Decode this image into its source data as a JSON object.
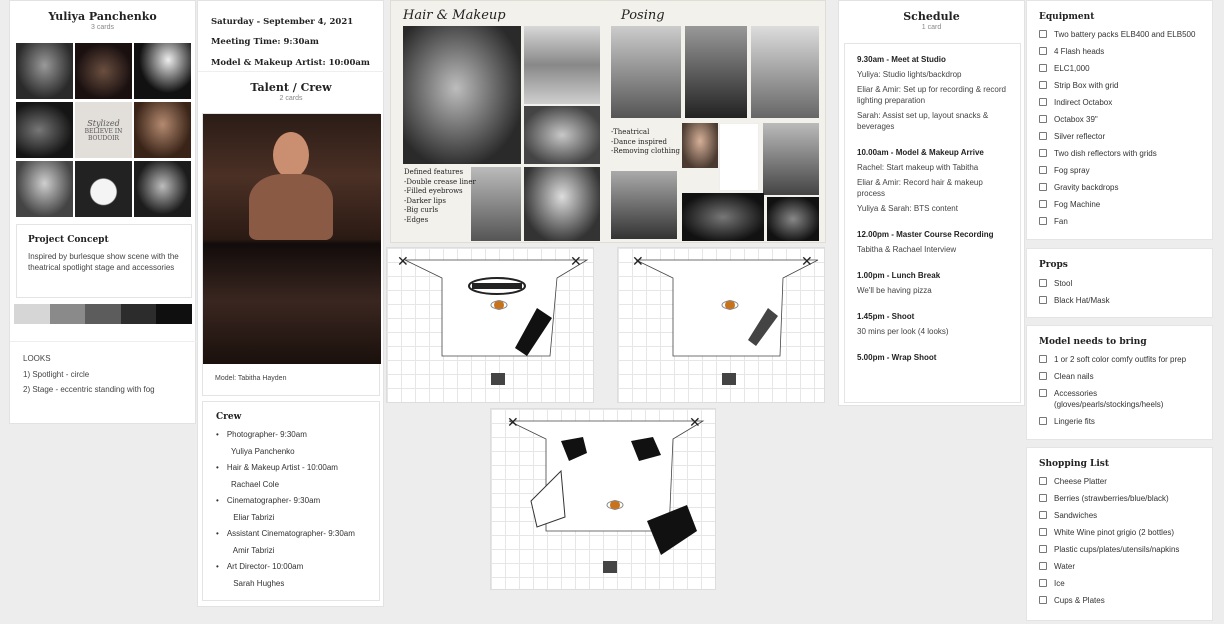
{
  "col1": {
    "title": "Yuliya Panchenko",
    "subtitle": "3 cards",
    "concept_title": "Project Concept",
    "concept_text": "Inspired by burlesque show scene with the theatrical spotlight stage and accessories",
    "palette": [
      "#d6d6d6",
      "#8a8a8a",
      "#5c5c5c",
      "#2c2c2c",
      "#0f0f0f"
    ],
    "looks_title": "LOOKS",
    "looks": [
      "1) Spotlight - circle",
      "2) Stage - eccentric standing with fog"
    ]
  },
  "col2": {
    "date": "Saturday -  September 4, 2021",
    "meeting": "Meeting Time:  9:30am",
    "artist": "Model & Makeup Artist: 10:00am",
    "talent_title": "Talent / Crew",
    "talent_sub": "2 cards",
    "model_caption": "Model: Tabitha Hayden",
    "crew_title": "Crew",
    "crew": [
      {
        "role": "Photographer- 9:30am",
        "name": "Yuliya Panchenko"
      },
      {
        "role": "Hair & Makeup Artist - 10:00am",
        "name": "Rachael Cole"
      },
      {
        "role": "Cinematographer- 9:30am",
        "name": " Eliar Tabrizi"
      },
      {
        "role": "Assistant Cinematographer- 9:30am",
        "name": " Amir Tabrizi"
      },
      {
        "role": "Art Director- 10:00am",
        "name": " Sarah Hughes"
      }
    ]
  },
  "moodboard": {
    "hair_title": "Hair & Makeup",
    "posing_title": "Posing",
    "hair_notes": [
      "Defined features",
      "-Double crease liner",
      "-Filled eyebrows",
      "-Darker lips",
      "-Big curls",
      "-Edges"
    ],
    "posing_notes": [
      "-Theatrical",
      "-Dance inspired",
      "-Removing clothing"
    ],
    "book_text": [
      "Stylized",
      "BELIEVE IN",
      "BOUDOIR"
    ]
  },
  "schedule": {
    "title": "Schedule",
    "subtitle": "1 card",
    "blocks": [
      {
        "time": "9.30am - Meet at Studio",
        "lines": [
          "Yuliya: Studio lights/backdrop",
          "Eliar & Amir:  Set up for recording & record lighting preparation",
          "Sarah: Assist set up, layout snacks & beverages"
        ]
      },
      {
        "time": "10.00am - Model & Makeup Arrive",
        "lines": [
          "Rachel: Start makeup with Tabitha",
          "Eliar & Amir: Record hair & makeup process",
          "Yuliya & Sarah: BTS content"
        ]
      },
      {
        "time": "12.00pm - Master Course Recording",
        "lines": [
          "Tabitha & Rachael Interview"
        ]
      },
      {
        "time": "1.00pm - Lunch Break",
        "lines": [
          "We'll be having pizza"
        ]
      },
      {
        "time": "1.45pm - Shoot",
        "lines": [
          "30 mins per look (4 looks)"
        ]
      },
      {
        "time": "5.00pm - Wrap Shoot",
        "lines": []
      }
    ]
  },
  "lists": {
    "equipment_title": "Equipment",
    "equipment": [
      "Two battery packs ELB400 and ELB500",
      "4 Flash heads",
      "ELC1,000",
      "Strip Box with grid",
      "Indirect Octabox",
      "Octabox 39\"",
      "Silver reflector",
      "Two dish reflectors with grids",
      "Fog spray",
      "Gravity backdrops",
      "Fog Machine",
      "Fan"
    ],
    "props_title": "Props",
    "props": [
      "Stool",
      "Black Hat/Mask"
    ],
    "model_title": "Model needs to bring",
    "model": [
      "1 or 2 soft color comfy outfits for prep",
      "Clean nails",
      "Accessories (gloves/pearls/stockings/heels)",
      "Lingerie fits"
    ],
    "shopping_title": "Shopping List",
    "shopping": [
      "Cheese Platter",
      "Berries (strawberries/blue/black)",
      "Sandwiches",
      "White Wine pinot grigio (2 bottles)",
      "Plastic cups/plates/utensils/napkins",
      "Water",
      "Ice",
      "Cups & Plates"
    ]
  }
}
